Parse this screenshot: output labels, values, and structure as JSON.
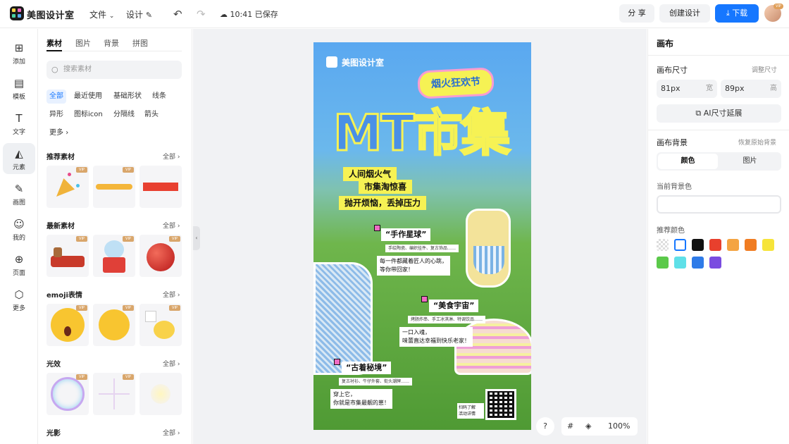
{
  "topbar": {
    "brand": "美图设计室",
    "menu_file": "文件",
    "menu_design": "设计",
    "saved_status": "10:41 已保存",
    "share_label": "分 享",
    "create_label": "创建设计",
    "download_label": "下载",
    "avatar_badge": "VIP",
    "colors": {
      "accent": "#1677ff"
    }
  },
  "leftnav": {
    "items": [
      {
        "label": "添加",
        "icon": "plus-square-icon"
      },
      {
        "label": "模板",
        "icon": "template-icon"
      },
      {
        "label": "文字",
        "icon": "text-icon"
      },
      {
        "label": "元素",
        "icon": "shapes-icon"
      },
      {
        "label": "画图",
        "icon": "draw-icon"
      },
      {
        "label": "我的",
        "icon": "user-icon"
      },
      {
        "label": "页面",
        "icon": "page-add-icon"
      },
      {
        "label": "更多",
        "icon": "cube-icon"
      }
    ],
    "active": "元素"
  },
  "assets": {
    "tabs": [
      "素材",
      "图片",
      "背景",
      "拼图"
    ],
    "active_tab": "素材",
    "search_placeholder": "搜索素材",
    "chips": [
      "全部",
      "最近使用",
      "基础形状",
      "线条",
      "异形",
      "图标icon",
      "分隔线",
      "箭头",
      "更多"
    ],
    "active_chip": "全部",
    "all_label": "全部",
    "vip_label": "VIP",
    "sections": [
      {
        "title": "推荐素材"
      },
      {
        "title": "最新素材"
      },
      {
        "title": "emoji表情"
      },
      {
        "title": "光效"
      },
      {
        "title": "光影"
      }
    ]
  },
  "poster": {
    "brand": "美图设计室",
    "badge": "烟火狂欢节",
    "title": "MT市集",
    "subtitle_1": "人间烟火气",
    "subtitle_2": "市集淘惊喜",
    "subtitle_3": "抛开烦恼，丢掉压力",
    "block_1": {
      "tag": "“手作星球”",
      "line": "手绘陶瓷、编织挂件、复古饰品……",
      "para": "每一件都藏着匠人的心跳，\n等你带回家！"
    },
    "block_2": {
      "tag": "“美食宇宙”",
      "line": "烤肠炸串、手工冰淇淋、特调饮品……",
      "para": "一口入魂，\n味蕾直达幸福到快乐老家！"
    },
    "block_3": {
      "tag": "“古着秘境”",
      "line": "复古衬衫、牛仔外套、街头潮牌……",
      "para": "穿上它，\n你就是市集最靓的崽！"
    },
    "qr_note": "扫码了解\n活动详情"
  },
  "canvas_tools": {
    "help": "?",
    "grid": "#",
    "zoom": "100%"
  },
  "right": {
    "title": "画布",
    "size_label": "画布尺寸",
    "size_link": "调整尺寸",
    "width_value": "81px",
    "width_unit": "宽",
    "height_value": "89px",
    "height_unit": "高",
    "ai_extend": "AI尺寸延展",
    "bg_label": "画布背景",
    "bg_reset": "恢复原始背景",
    "seg_color": "颜色",
    "seg_image": "图片",
    "current_bg": "当前背景色",
    "recommend": "推荐颜色",
    "swatches": [
      "transparent",
      "#ffffff",
      "#111111",
      "#e8402d",
      "#f4a442",
      "#f07c22",
      "#f6e43a",
      "#5bc94a",
      "#5fe0e8",
      "#2f7be8",
      "#7a4ce0"
    ]
  }
}
